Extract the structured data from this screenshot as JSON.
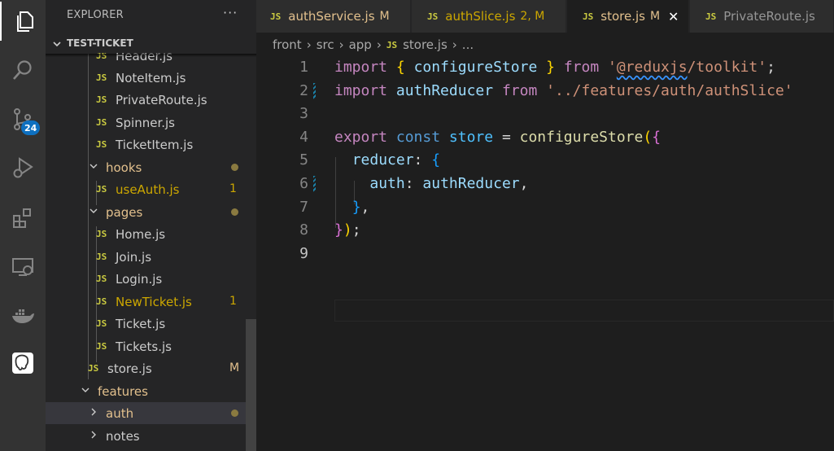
{
  "activity_bar": {
    "items": [
      {
        "icon": "files-icon"
      },
      {
        "icon": "search-icon"
      },
      {
        "icon": "source-control-icon",
        "badge": "24"
      },
      {
        "icon": "run-debug-icon"
      },
      {
        "icon": "extensions-icon"
      },
      {
        "icon": "remote-explorer-icon"
      },
      {
        "icon": "docker-icon"
      },
      {
        "icon": "postgres-icon"
      }
    ]
  },
  "explorer": {
    "title": "EXPLORER",
    "more": "···",
    "project": "TEST-TICKET",
    "rows": [
      {
        "name": "Header.js",
        "type": "file"
      },
      {
        "name": "NoteItem.js",
        "type": "file"
      },
      {
        "name": "PrivateRoute.js",
        "type": "file"
      },
      {
        "name": "Spinner.js",
        "type": "file"
      },
      {
        "name": "TicketItem.js",
        "type": "file"
      },
      {
        "name": "hooks",
        "type": "folder"
      },
      {
        "name": "useAuth.js",
        "type": "file",
        "status": "1"
      },
      {
        "name": "pages",
        "type": "folder"
      },
      {
        "name": "Home.js",
        "type": "file"
      },
      {
        "name": "Join.js",
        "type": "file"
      },
      {
        "name": "Login.js",
        "type": "file"
      },
      {
        "name": "NewTicket.js",
        "type": "file",
        "status": "1"
      },
      {
        "name": "Ticket.js",
        "type": "file"
      },
      {
        "name": "Tickets.js",
        "type": "file"
      },
      {
        "name": "store.js",
        "type": "file",
        "status": "M"
      },
      {
        "name": "features",
        "type": "folder"
      },
      {
        "name": "auth",
        "type": "folder"
      },
      {
        "name": "notes",
        "type": "folder"
      }
    ]
  },
  "tabs": [
    {
      "label": "authService.js",
      "status": "M"
    },
    {
      "label": "authSlice.js",
      "status": "2, M"
    },
    {
      "label": "store.js",
      "status": "M",
      "close": "✕"
    },
    {
      "label": "PrivateRoute.js",
      "status": ""
    }
  ],
  "breadcrumb": {
    "parts": [
      "front",
      "src",
      "app",
      "store.js",
      "..."
    ]
  },
  "file_badge": "JS",
  "editor": {
    "line_numbers": [
      "1",
      "2",
      "3",
      "4",
      "5",
      "6",
      "7",
      "8",
      "9"
    ],
    "tokens": {
      "l1_import": "import",
      "l1_ob": "{",
      "l1_name": "configureStore",
      "l1_cb": "}",
      "l1_from": "from",
      "l1_q1": "'",
      "l1_pkg": "@reduxjs",
      "l1_path": "/toolkit'",
      "l1_semi": ";",
      "l2_import": "import",
      "l2_name": "authReducer",
      "l2_from": "from",
      "l2_path": "'../features/auth/authSlice'",
      "l4_export": "export",
      "l4_const": "const",
      "l4_store": "store",
      "l4_eq": "=",
      "l4_fn": "configureStore",
      "l4_op": "(",
      "l4_ob": "{",
      "l5_key": "reducer",
      "l5_colon": ":",
      "l5_ob": "{",
      "l6_key": "auth",
      "l6_colon": ":",
      "l6_val": "authReducer",
      "l6_comma": ",",
      "l7_cb": "}",
      "l7_comma": ",",
      "l8_cb": "}",
      "l8_cp": ")",
      "l8_semi": ";"
    }
  }
}
